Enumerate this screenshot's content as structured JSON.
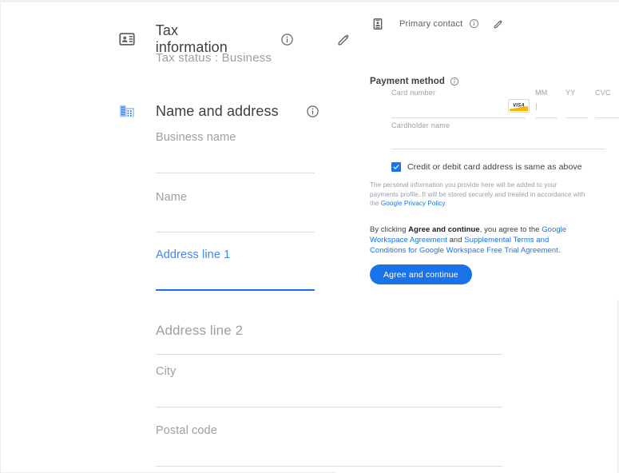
{
  "theme": {
    "accent_blue": "#1a73e8",
    "link_blue": "#1a73e8",
    "label_gray": "#9aa0a6",
    "text_gray": "#3c4043",
    "line_gray": "#dadce0"
  },
  "left": {
    "tax_section": {
      "icon": "contact-card-icon",
      "title": "Tax information",
      "info_icon": "info-icon",
      "edit_icon": "pencil-icon",
      "status_label": "Tax status : Business"
    },
    "address_section": {
      "icon": "building-icon",
      "title": "Name and address",
      "info_icon": "info-icon"
    },
    "fields": {
      "business_name": {
        "label": "Business name",
        "value": "",
        "focused": false
      },
      "name": {
        "label": "Name",
        "value": "",
        "focused": false
      },
      "address_line_1": {
        "label": "Address line 1",
        "value": "",
        "focused": true
      },
      "address_line_2": {
        "label": "Address line 2",
        "value": "",
        "focused": false
      },
      "city": {
        "label": "City",
        "value": "",
        "focused": false
      },
      "postal_code": {
        "label": "Postal code",
        "value": "",
        "focused": false
      }
    }
  },
  "right": {
    "primary_contact": {
      "icon": "contact-card-icon",
      "title": "Primary contact",
      "info_icon": "info-icon",
      "edit_icon": "pencil-icon"
    },
    "payment_method": {
      "title": "Payment method",
      "info_icon": "info-icon",
      "card_number": {
        "label": "Card number",
        "value": ""
      },
      "brand_icon": "visa-card-icon",
      "brand_text": "VISA",
      "expiry_month": {
        "label": "MM",
        "value": ""
      },
      "expiry_year": {
        "label": "YY",
        "value": ""
      },
      "cvc": {
        "label": "CVC",
        "value": ""
      },
      "cardholder_name": {
        "label": "Cardholder name",
        "value": ""
      }
    },
    "same_address_checkbox": {
      "label": "Credit or debit card address is same as above",
      "checked": true
    },
    "fineprint": {
      "part1": "The personal information you provide here will be added to your payments profile. It will be stored securely and treated in accordance with the ",
      "link": "Google Privacy Policy",
      "part2": "."
    },
    "agreement": {
      "part1": "By clicking ",
      "bold": "Agree and continue",
      "part2": ", you agree to the ",
      "link1": "Google Workspace Agreement",
      "part3": " and ",
      "link2": "Supplemental Terms and Conditions for Google Workspace Free Trial Agreement",
      "part4": "."
    },
    "submit_button": "Agree and continue"
  }
}
